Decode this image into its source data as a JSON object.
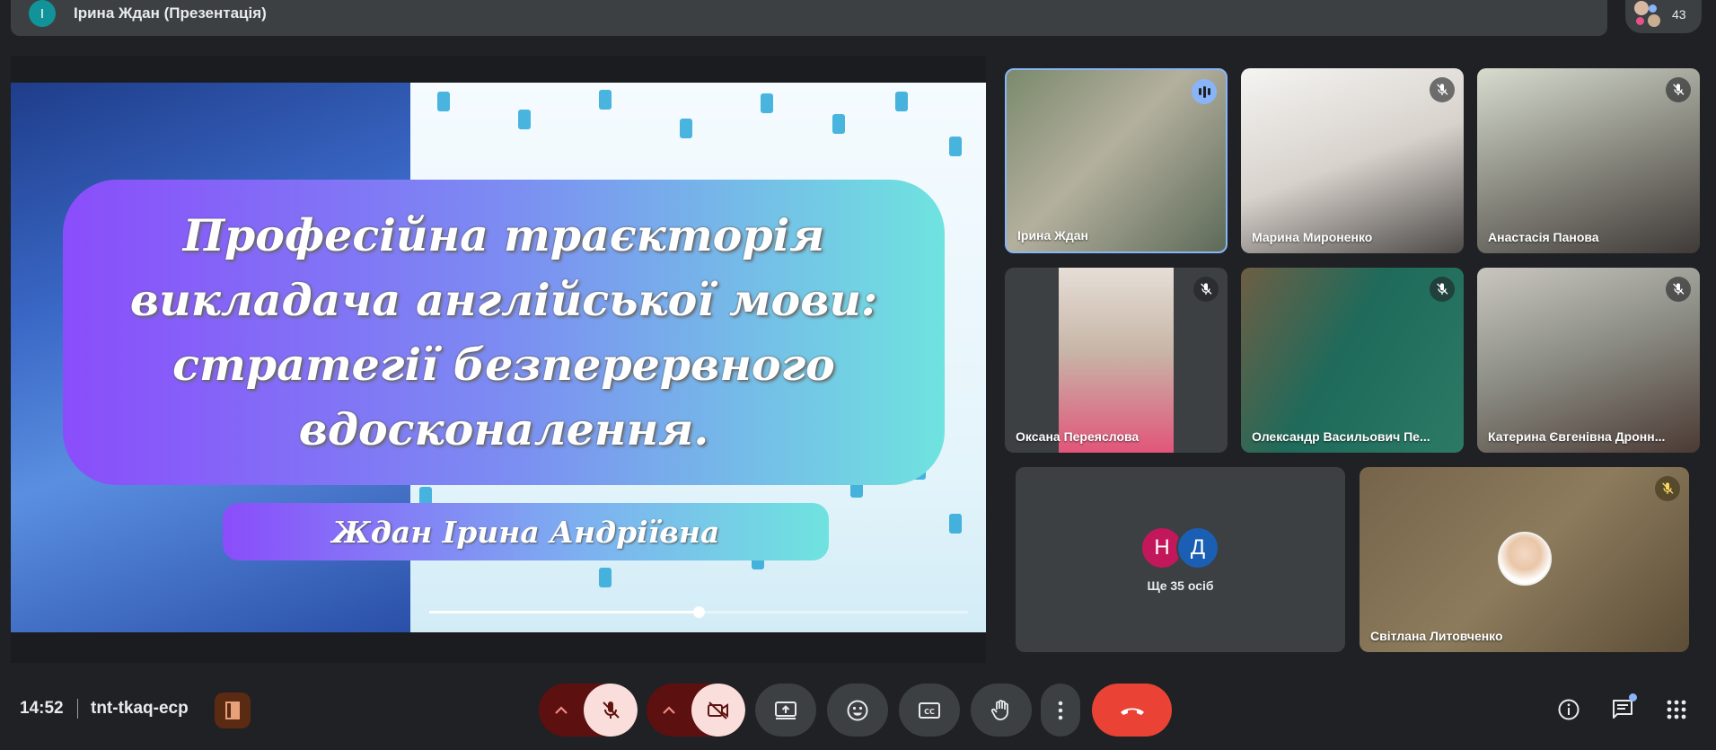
{
  "topbar": {
    "presenter_initial": "І",
    "presenter_label": "Ірина Ждан (Презентація)",
    "participant_count": "43"
  },
  "slide": {
    "title": "Професійна траєкторія викладача англійської мови: стратегії безперервного вдосконалення.",
    "author": "Ждан Ірина Андріївна",
    "progress_percent": 50
  },
  "tiles": {
    "zhdan": "Ірина Ждан",
    "mironenko": "Марина Мироненко",
    "panova": "Анастасія Панова",
    "pereyaslova": "Оксана Переяслова",
    "oleksandr": "Олександр Васильович Пе...",
    "dronn": "Катерина Євгенівна Дронн...",
    "lytovchenko": "Світлана Литовченко"
  },
  "more": {
    "initials": [
      "Н",
      "Д"
    ],
    "label": "Ще 35 осіб"
  },
  "bottombar": {
    "time": "14:52",
    "meeting_code": "tnt-tkaq-ecp"
  },
  "icons": {
    "speaking": "audio-level-icon",
    "muted": "mic-off-icon",
    "camera_off": "videocam-off-icon",
    "present": "present-to-all-icon",
    "emoji": "emoji-icon",
    "captions": "closed-caption-icon",
    "hand": "raise-hand-icon",
    "more": "more-vert-icon",
    "end": "call-end-icon",
    "info": "info-icon",
    "chat": "chat-icon",
    "apps": "apps-grid-icon"
  },
  "colors": {
    "background": "#202124",
    "surface": "#3c4043",
    "accent_blue": "#8ab4f8",
    "end_call_red": "#ea4335",
    "muted_control_bg": "#f9dedc"
  }
}
